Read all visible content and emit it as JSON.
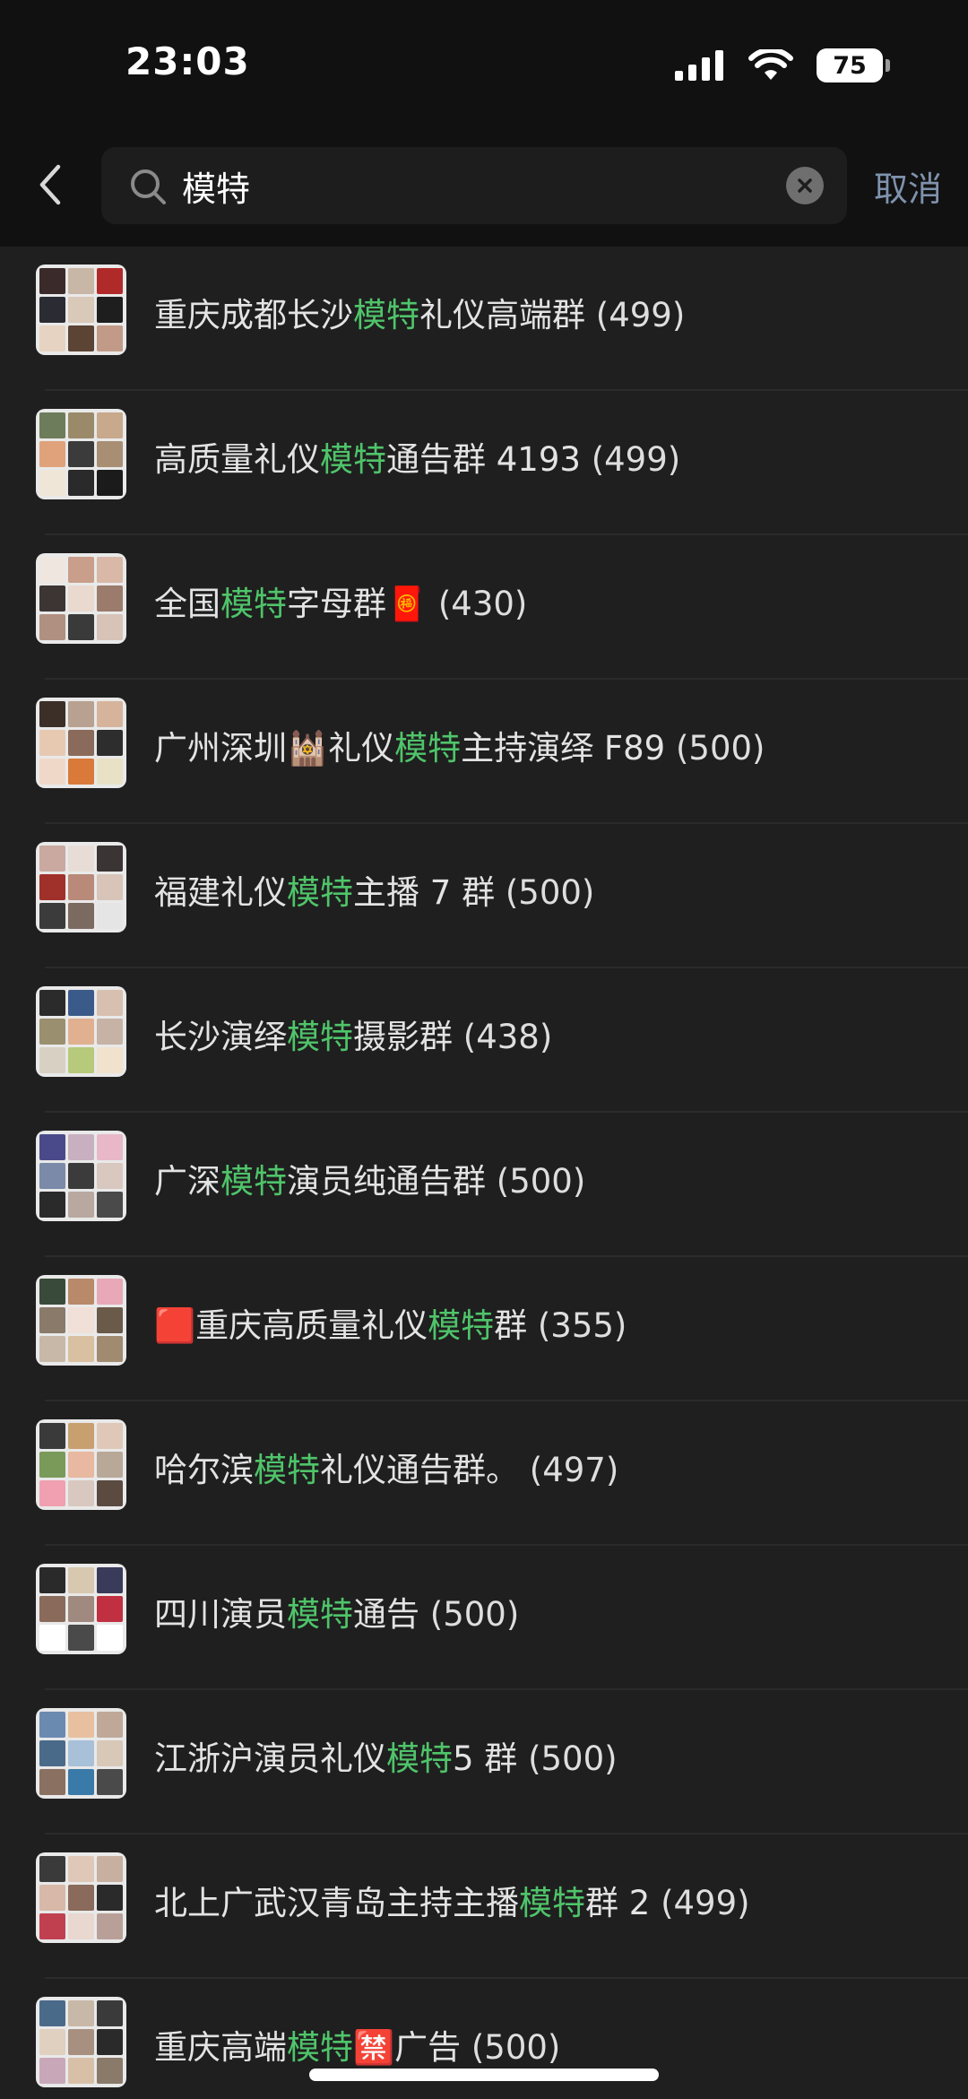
{
  "status_bar": {
    "time": "23:03",
    "battery_level": "75",
    "signal_icon": "cellular-signal-icon",
    "wifi_icon": "wifi-icon"
  },
  "search": {
    "back_icon": "chevron-left-icon",
    "search_icon": "magnifier-icon",
    "query": "模特",
    "clear_icon": "clear-x-icon",
    "cancel_label": "取消",
    "highlight_color": "#4fc46a"
  },
  "results": [
    {
      "before": "重庆成都长沙",
      "match": "模特",
      "after": "礼仪高端群",
      "count": "(499)"
    },
    {
      "before": "高质量礼仪",
      "match": "模特",
      "after": "通告群 4193",
      "count": "(499)"
    },
    {
      "before": "全国",
      "match": "模特",
      "after": "字母群🧧",
      "count": "(430)"
    },
    {
      "before": "广州深圳🕍礼仪",
      "match": "模特",
      "after": "主持演绎 F89",
      "count": "(500)"
    },
    {
      "before": "福建礼仪",
      "match": "模特",
      "after": "主播 7 群",
      "count": "(500)"
    },
    {
      "before": "长沙演绎",
      "match": "模特",
      "after": "摄影群",
      "count": "(438)"
    },
    {
      "before": "广深",
      "match": "模特",
      "after": "演员纯通告群",
      "count": "(500)"
    },
    {
      "before": "🟥重庆高质量礼仪",
      "match": "模特",
      "after": "群",
      "count": "(355)"
    },
    {
      "before": "哈尔滨",
      "match": "模特",
      "after": "礼仪通告群。",
      "count": "(497)"
    },
    {
      "before": "四川演员",
      "match": "模特",
      "after": "通告",
      "count": "(500)"
    },
    {
      "before": "江浙沪演员礼仪",
      "match": "模特",
      "after": "5 群",
      "count": "(500)"
    },
    {
      "before": "北上广武汉青岛主持主播",
      "match": "模特",
      "after": "群 2",
      "count": "(499)"
    },
    {
      "before": "重庆高端",
      "match": "模特",
      "after": "🈲广告",
      "count": "(500)"
    }
  ]
}
